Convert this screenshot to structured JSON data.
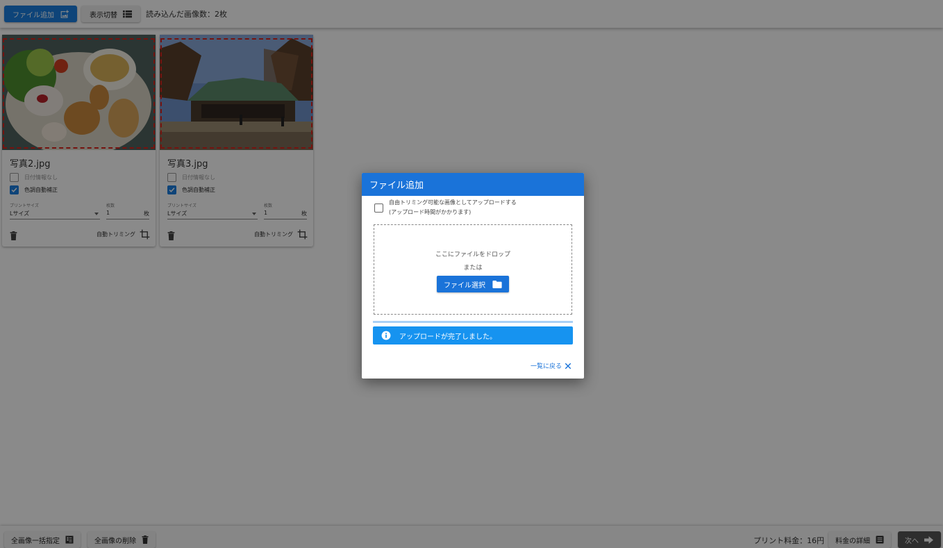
{
  "toolbar": {
    "add_file_label": "ファイル追加",
    "toggle_view_label": "表示切替",
    "loaded_count": "読み込んだ画像数：2枚"
  },
  "cards": [
    {
      "filename": "写真2.jpg",
      "no_date_label": "日付情報なし",
      "color_correct_label": "色調自動補正",
      "print_size_label": "プリントサイズ",
      "print_size_value": "Lサイズ",
      "qty_label": "枚数",
      "qty_value": "1",
      "qty_unit": "枚",
      "auto_trim_label": "自動トリミング"
    },
    {
      "filename": "写真3.jpg",
      "no_date_label": "日付情報なし",
      "color_correct_label": "色調自動補正",
      "print_size_label": "プリントサイズ",
      "print_size_value": "Lサイズ",
      "qty_label": "枚数",
      "qty_value": "1",
      "qty_unit": "枚",
      "auto_trim_label": "自動トリミング"
    }
  ],
  "dialog": {
    "title": "ファイル追加",
    "free_trim_line1": "自由トリミング可能な画像としてアップロードする",
    "free_trim_line2": "(アップロード時間がかかります)",
    "drop_text": "ここにファイルをドロップ",
    "or_text": "または",
    "select_button": "ファイル選択",
    "progress": 1.0,
    "alert_text": "アップロードが完了しました。",
    "back_label": "一覧に戻る"
  },
  "bottom": {
    "bulk_label": "全画像一括指定",
    "delete_all_label": "全画像の削除",
    "price_text": "プリント料金：16円",
    "detail_label": "料金の詳細",
    "next_label": "次へ"
  },
  "colors": {
    "primary": "#1a73d9",
    "alert": "#1693f0",
    "trim_border": "#d9231c"
  }
}
